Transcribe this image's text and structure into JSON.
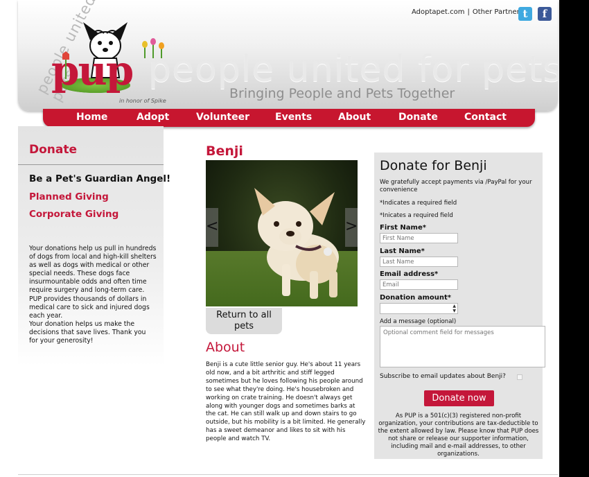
{
  "header": {
    "logo_arc_text": "people united for pets",
    "logo_text": "pup",
    "logo_caption": "in honor of Spike",
    "big_title": "people united for pets",
    "tagline": "Bringing People and Pets Together",
    "top_links": [
      "Adoptapet.com",
      "Other Partners"
    ],
    "social": {
      "twitter_glyph": "t",
      "facebook_glyph": "f"
    }
  },
  "nav": {
    "items": [
      "Home",
      "Adopt",
      "Volunteer",
      "Events",
      "About",
      "Donate",
      "Contact"
    ]
  },
  "sidebar": {
    "heading": "Donate",
    "guardian": "Be a Pet's Guardian Angel!",
    "links": [
      "Planned Giving",
      "Corporate Giving"
    ],
    "paragraph_1": "Your donations help us pull in hundreds of dogs from local and high-kill shelters as well as dogs with medical or other special needs. These dogs face insurmountable odds and often time require surgery and long-term care. PUP provides thousands of dollars in medical care to sick and injured dogs each year.",
    "paragraph_2": "Your donation helps us make the decisions that save lives. Thank you for your generosity!"
  },
  "pet": {
    "name": "Benji",
    "prev_arrow": "<",
    "next_arrow": ">",
    "return_label": "Return to all pets",
    "about_heading": "About",
    "about_text": "Benji is a cute little senior guy. He's about 11 years old now, and a bit arthritic and stiff legged sometimes but he loves following his people around to see what they're doing. He's housebroken and working on crate training. He doesn't always get along with younger dogs and sometimes barks at the cat. He can still walk up and down stairs to go outside, but his mobility is a bit limited. He generally has a sweet demeanor and likes to sit with his people and watch TV."
  },
  "form": {
    "title": "Donate for Benji",
    "intro": "We gratefully accept payments via /PayPal for your convenience",
    "required_1": "*Indicates a required field",
    "required_2": "*Inicates a required field",
    "first_name_label": "First Name*",
    "first_name_placeholder": "First Name",
    "last_name_label": "Last Name*",
    "last_name_placeholder": "Last Name",
    "email_label": "Email address*",
    "email_placeholder": "Email",
    "amount_label": "Donation amount*",
    "message_label": "Add a message (optional)",
    "message_placeholder": "Optional comment field for messages",
    "subscribe_label": "Subscribe to email updates about Benji?",
    "submit_label": "Donate now",
    "legal": "As PUP is a 501(c)(3) registered non-profit organization, your contributions are tax-deductible to the extent allowed by law. Please know that PUP does not share or release our supporter information, including mail and e-mail addresses, to other organizations."
  },
  "colors": {
    "brand_red": "#c4173a",
    "nav_red": "#c7162f",
    "twitter_blue": "#3fa9e0",
    "facebook_blue": "#3b5998"
  }
}
